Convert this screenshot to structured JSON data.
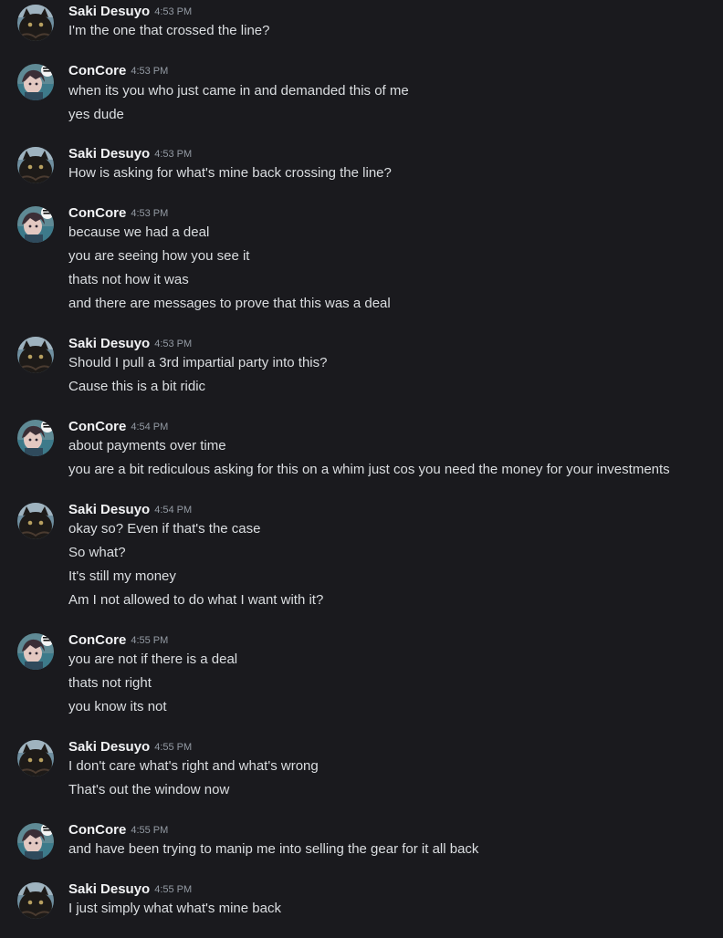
{
  "users": {
    "saki": "Saki Desuyo",
    "concore": "ConCore"
  },
  "colors": {
    "background": "#1a1a1e",
    "text": "#dbdee1",
    "username": "#f2f3f5",
    "timestamp": "#949ba4"
  },
  "avatars": {
    "saki": "dark-cat-avatar-icon",
    "concore": "anime-character-avatar-icon"
  },
  "messages": [
    {
      "author": "Saki Desuyo",
      "time": "4:53 PM",
      "lines": [
        "I'm the one that crossed the line?"
      ]
    },
    {
      "author": "ConCore",
      "time": "4:53 PM",
      "lines": [
        "when its you who just came in and demanded this of me",
        "yes dude"
      ]
    },
    {
      "author": "Saki Desuyo",
      "time": "4:53 PM",
      "lines": [
        "How is asking for what's mine back crossing the line?"
      ]
    },
    {
      "author": "ConCore",
      "time": "4:53 PM",
      "lines": [
        "because we had a deal",
        "you are seeing how you see it",
        "thats not how it was",
        "and there are messages to prove that this was a deal"
      ]
    },
    {
      "author": "Saki Desuyo",
      "time": "4:53 PM",
      "lines": [
        "Should I pull a 3rd impartial party into this?",
        "Cause this is a bit ridic"
      ]
    },
    {
      "author": "ConCore",
      "time": "4:54 PM",
      "lines": [
        "about payments over time",
        "you are a bit rediculous asking for this on a whim just cos you need the money for your investments"
      ]
    },
    {
      "author": "Saki Desuyo",
      "time": "4:54 PM",
      "lines": [
        "okay so? Even if that's the case",
        "So what?",
        "It's still my money",
        "Am I not allowed to do what I want with it?"
      ]
    },
    {
      "author": "ConCore",
      "time": "4:55 PM",
      "lines": [
        "you are not if there is a deal",
        "thats not right",
        "you know its not"
      ]
    },
    {
      "author": "Saki Desuyo",
      "time": "4:55 PM",
      "lines": [
        "I don't care what's right and what's wrong",
        "That's out the window now"
      ]
    },
    {
      "author": "ConCore",
      "time": "4:55 PM",
      "lines": [
        "and have been trying to manip me into selling the gear for it all back"
      ]
    },
    {
      "author": "Saki Desuyo",
      "time": "4:55 PM",
      "lines": [
        "I just simply what what's mine back"
      ]
    }
  ]
}
